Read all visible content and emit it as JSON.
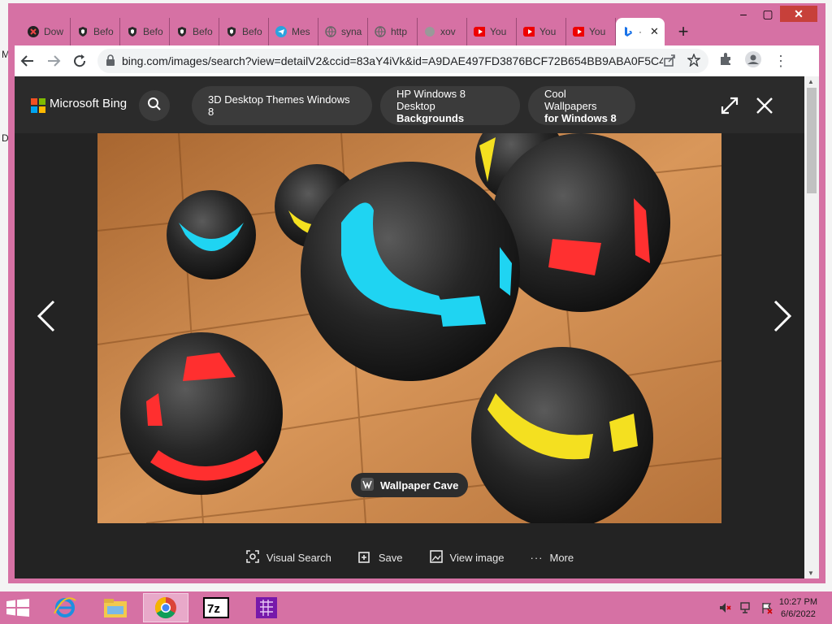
{
  "browser": {
    "tabs": [
      {
        "title": "Dow",
        "icon": "download-icon"
      },
      {
        "title": "Befo",
        "icon": "shield-icon"
      },
      {
        "title": "Befo",
        "icon": "shield-icon"
      },
      {
        "title": "Befo",
        "icon": "shield-icon"
      },
      {
        "title": "Befo",
        "icon": "shield-icon"
      },
      {
        "title": "Mes",
        "icon": "telegram-icon"
      },
      {
        "title": "syna",
        "icon": "globe-icon"
      },
      {
        "title": "http",
        "icon": "globe-icon"
      },
      {
        "title": "xov",
        "icon": "globe-icon"
      },
      {
        "title": "You",
        "icon": "youtube-icon"
      },
      {
        "title": "You",
        "icon": "youtube-icon"
      },
      {
        "title": "You",
        "icon": "youtube-icon"
      },
      {
        "title": "·",
        "icon": "bing-icon",
        "active": true
      }
    ],
    "url": "bing.com/images/search?view=detailV2&ccid=83aY4iVk&id=A9DAE497FD3876BCF72B654BB9ABA0F5C45..."
  },
  "bing": {
    "brand": "Microsoft Bing",
    "chips": [
      {
        "line1": "3D Desktop Themes Windows 8",
        "line2": ""
      },
      {
        "line1": "HP Windows 8 Desktop",
        "line2": "Backgrounds"
      },
      {
        "line1": "Cool Wallpapers",
        "line2": "for Windows 8"
      }
    ],
    "source": "Wallpaper Cave",
    "actions": {
      "visual_search": "Visual Search",
      "save": "Save",
      "view_image": "View image",
      "more": "More"
    }
  },
  "desktop": {
    "letters": [
      "M",
      "D"
    ]
  },
  "taskbar": {
    "time": "10:27 PM",
    "date": "6/6/2022",
    "apps": [
      "internet-explorer-icon",
      "file-explorer-icon",
      "chrome-icon",
      "7zip-icon",
      "onenote-icon"
    ]
  },
  "colors": {
    "window_frame": "#d671a4",
    "viewer_bg": "#232323",
    "close_button": "#c7403a"
  }
}
